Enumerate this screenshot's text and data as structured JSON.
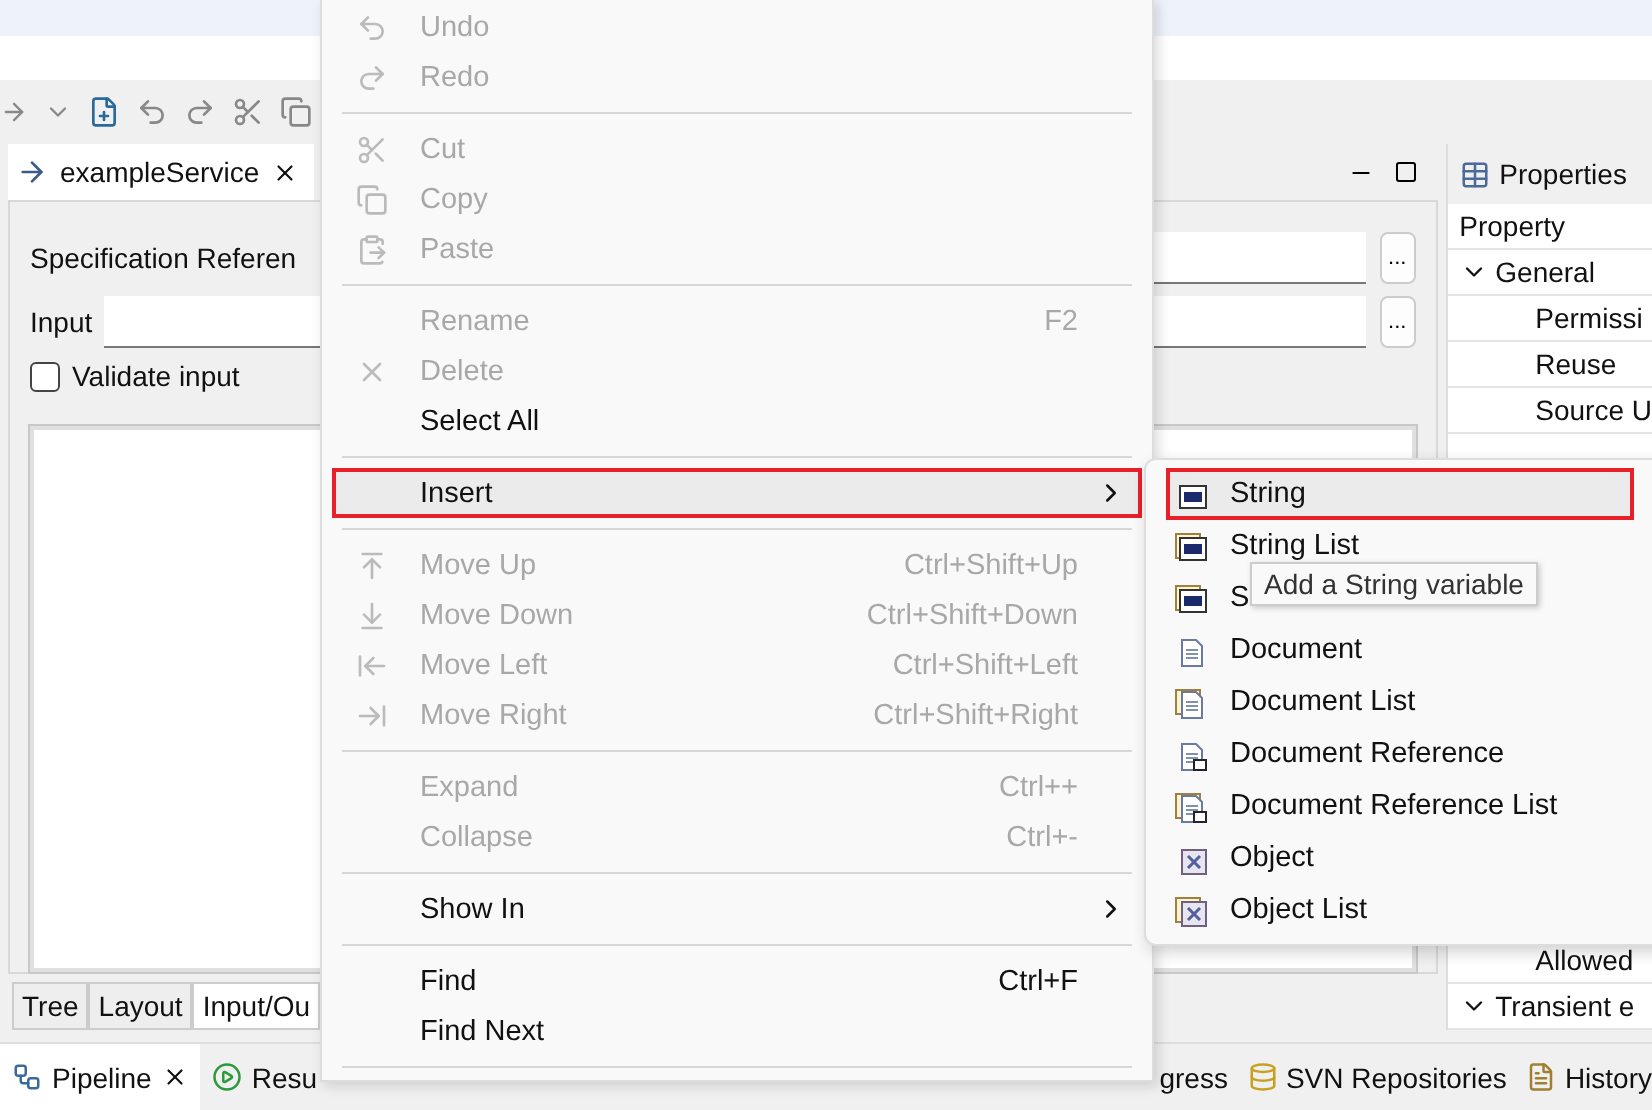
{
  "editor": {
    "tab": {
      "label": "exampleService",
      "selected": true
    },
    "spec_label": "Specification Referen",
    "input_label": "Input",
    "validate": {
      "label": "Validate input",
      "checked": false
    },
    "browse_buttons": [
      "...",
      "..."
    ],
    "bottom_tabs": [
      {
        "label": "Tree",
        "selected": false
      },
      {
        "label": "Layout",
        "selected": false
      },
      {
        "label": "Input/Ou",
        "selected": true
      }
    ]
  },
  "properties": {
    "title": "Properties",
    "column": "Property",
    "rows_top": [
      {
        "kind": "group",
        "label": "General",
        "expanded": true
      },
      {
        "kind": "prop",
        "label": "Permissi"
      },
      {
        "kind": "prop",
        "label": "Reuse"
      },
      {
        "kind": "prop",
        "label": "Source U"
      }
    ],
    "rows_bottom": [
      {
        "kind": "prop",
        "label": "Allowed"
      },
      {
        "kind": "group",
        "label": "Transient e",
        "expanded": true
      }
    ]
  },
  "views_left": [
    {
      "label": "Pipeline",
      "selected": true
    },
    {
      "label": "Resu",
      "selected": false
    }
  ],
  "views_right": [
    {
      "label": "gress"
    },
    {
      "label": "SVN Repositories"
    },
    {
      "label": "History"
    }
  ],
  "context_menu": {
    "items": [
      {
        "kind": "item",
        "label": "Undo",
        "disabled": true,
        "selected": false
      },
      {
        "kind": "item",
        "label": "Redo",
        "disabled": true,
        "selected": false
      },
      {
        "kind": "separator"
      },
      {
        "kind": "item",
        "label": "Cut",
        "disabled": true,
        "selected": false
      },
      {
        "kind": "item",
        "label": "Copy",
        "disabled": true,
        "selected": false
      },
      {
        "kind": "item",
        "label": "Paste",
        "disabled": true,
        "selected": false
      },
      {
        "kind": "separator"
      },
      {
        "kind": "item",
        "label": "Rename",
        "shortcut": "F2",
        "disabled": true,
        "selected": false
      },
      {
        "kind": "item",
        "label": "Delete",
        "disabled": true,
        "selected": false
      },
      {
        "kind": "item",
        "label": "Select All",
        "disabled": false,
        "selected": false
      },
      {
        "kind": "separator"
      },
      {
        "kind": "item",
        "label": "Insert",
        "disabled": false,
        "selected": true,
        "submenu": true
      },
      {
        "kind": "separator"
      },
      {
        "kind": "item",
        "label": "Move Up",
        "shortcut": "Ctrl+Shift+Up",
        "disabled": true,
        "selected": false
      },
      {
        "kind": "item",
        "label": "Move Down",
        "shortcut": "Ctrl+Shift+Down",
        "disabled": true,
        "selected": false
      },
      {
        "kind": "item",
        "label": "Move Left",
        "shortcut": "Ctrl+Shift+Left",
        "disabled": true,
        "selected": false
      },
      {
        "kind": "item",
        "label": "Move Right",
        "shortcut": "Ctrl+Shift+Right",
        "disabled": true,
        "selected": false
      },
      {
        "kind": "separator"
      },
      {
        "kind": "item",
        "label": "Expand",
        "shortcut": "Ctrl++",
        "disabled": true,
        "selected": false
      },
      {
        "kind": "item",
        "label": "Collapse",
        "shortcut": "Ctrl+-",
        "disabled": true,
        "selected": false
      },
      {
        "kind": "separator"
      },
      {
        "kind": "item",
        "label": "Show In",
        "disabled": false,
        "selected": false,
        "submenu": true
      },
      {
        "kind": "separator"
      },
      {
        "kind": "item",
        "label": "Find",
        "shortcut": "Ctrl+F",
        "disabled": false,
        "selected": false
      },
      {
        "kind": "item",
        "label": "Find Next",
        "disabled": false,
        "selected": false
      },
      {
        "kind": "separator"
      }
    ]
  },
  "submenu": {
    "items": [
      {
        "label": "String",
        "selected": true
      },
      {
        "label": "String List",
        "selected": false
      },
      {
        "label": "S",
        "selected": false
      },
      {
        "label": "Document",
        "selected": false
      },
      {
        "label": "Document List",
        "selected": false
      },
      {
        "label": "Document Reference",
        "selected": false
      },
      {
        "label": "Document Reference List",
        "selected": false
      },
      {
        "label": "Object",
        "selected": false
      },
      {
        "label": "Object List",
        "selected": false
      }
    ]
  },
  "tooltip": "Add a String variable"
}
